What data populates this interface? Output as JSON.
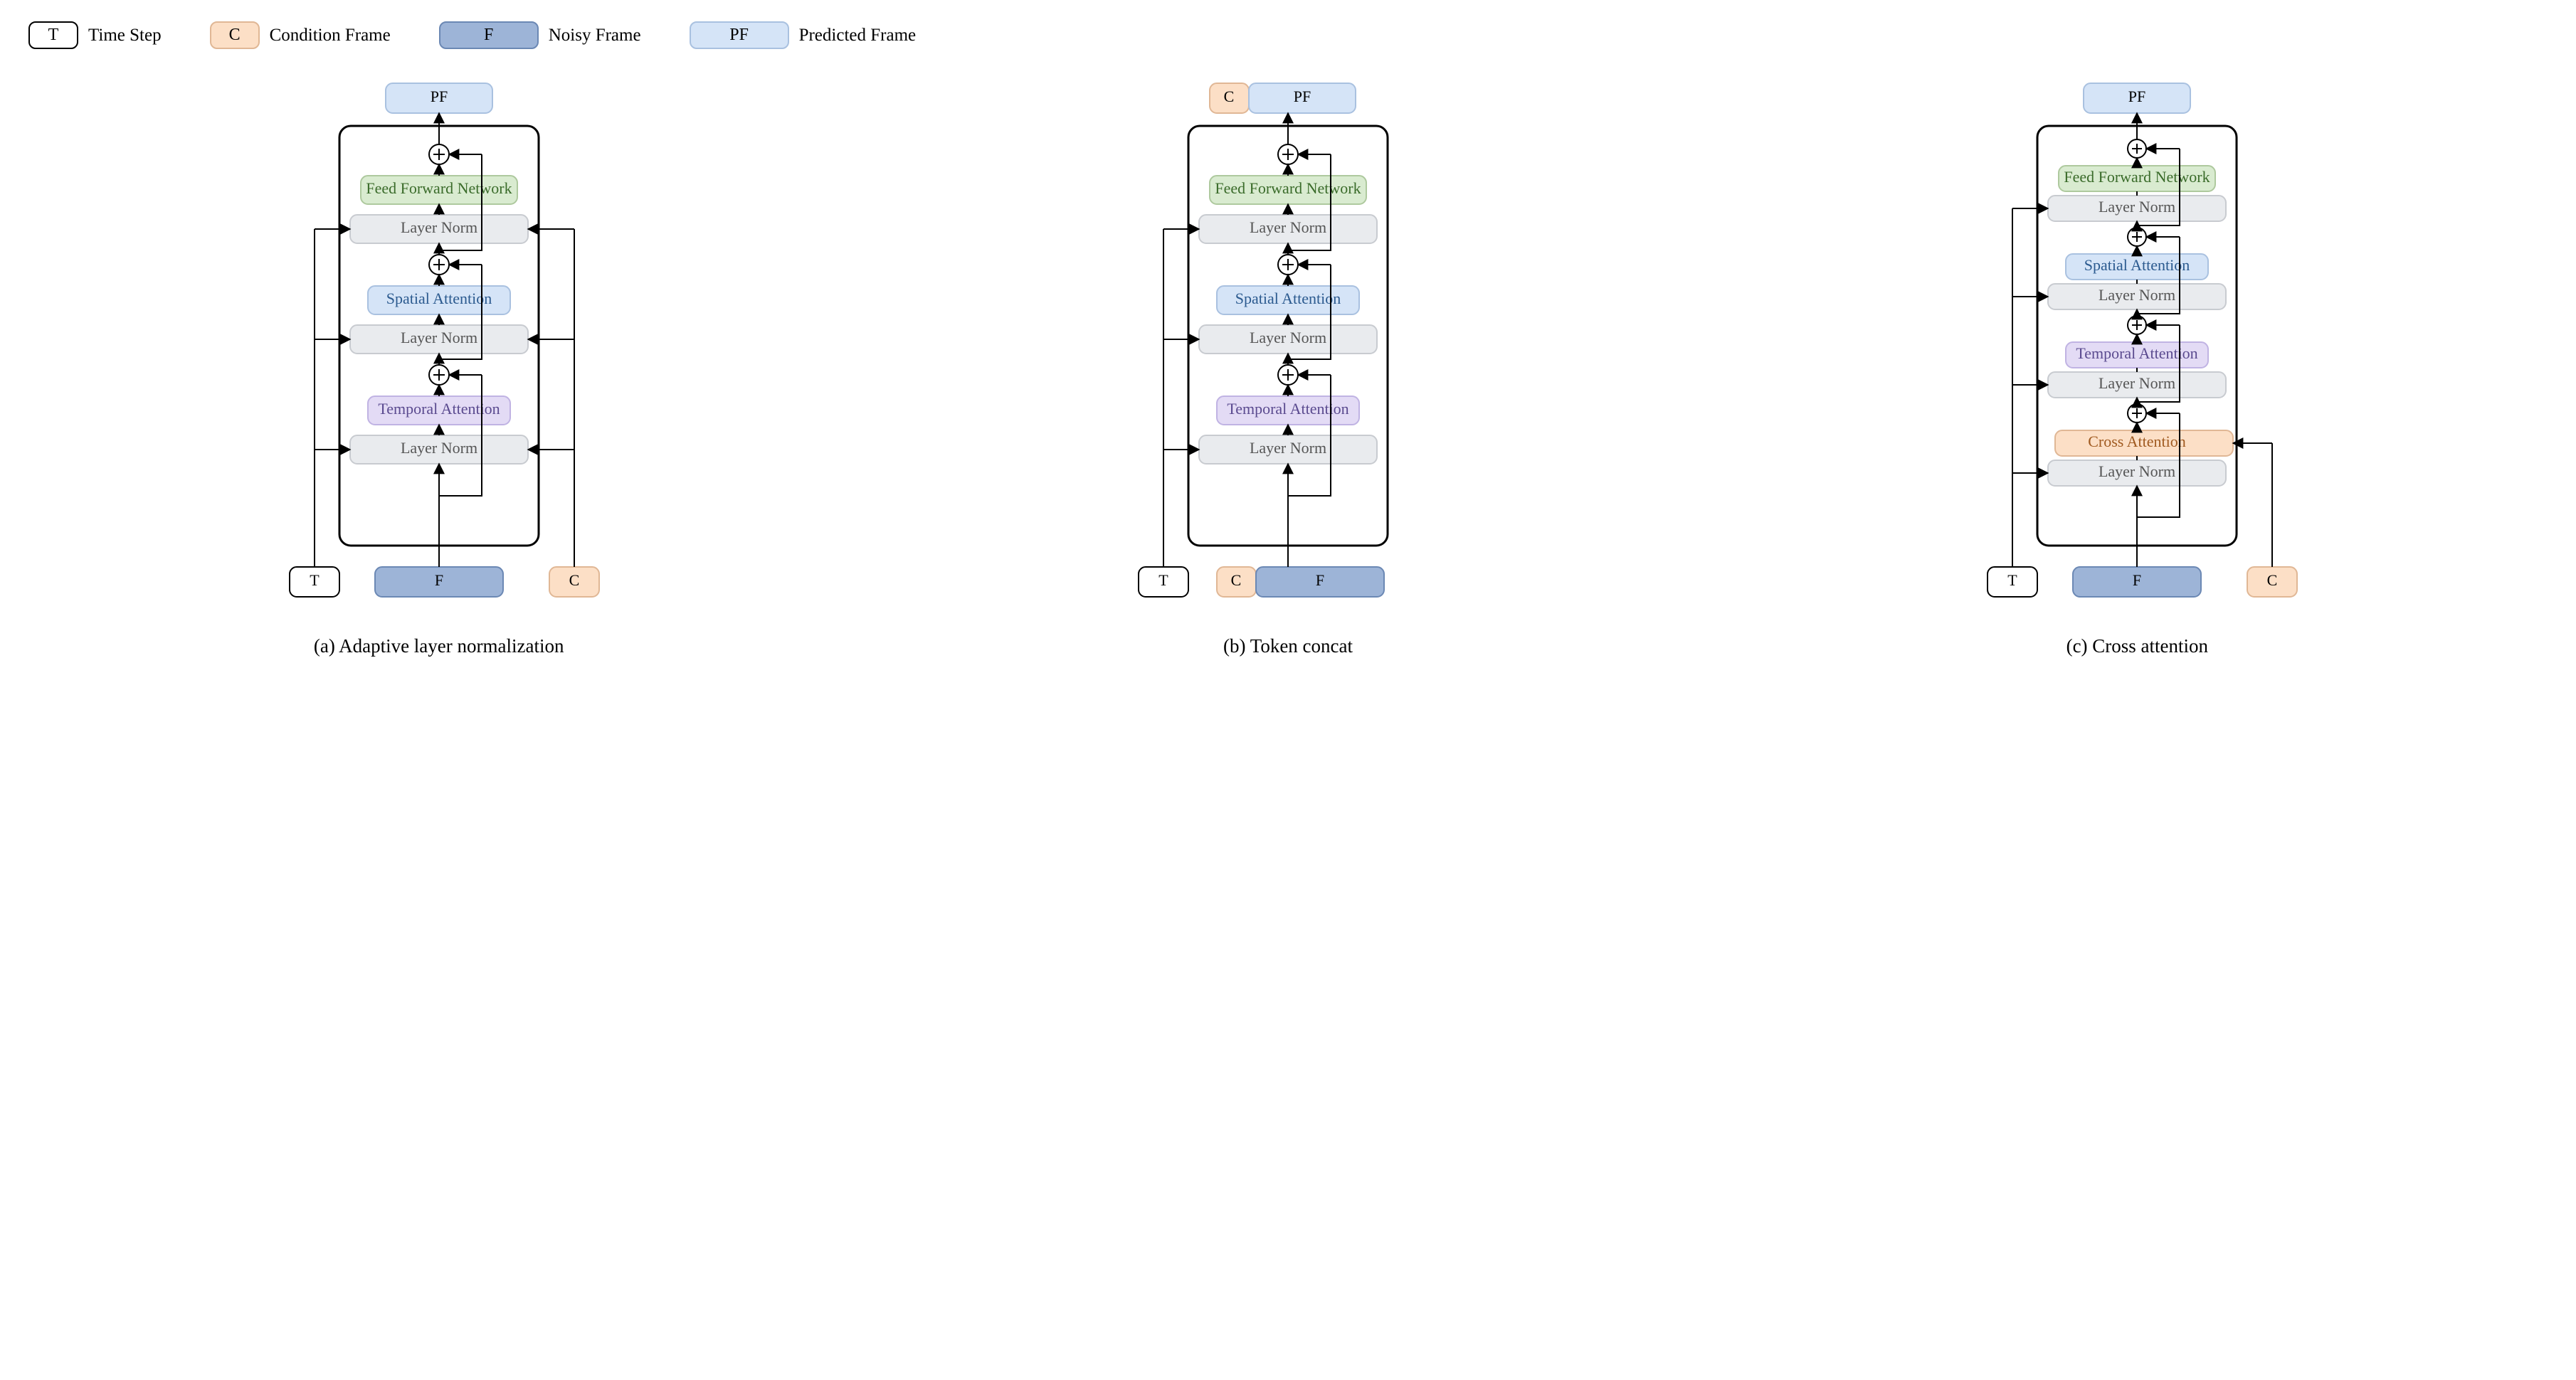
{
  "legend": {
    "t_box": "T",
    "t_label": "Time Step",
    "c_box": "C",
    "c_label": "Condition Frame",
    "f_box": "F",
    "f_label": "Noisy Frame",
    "pf_box": "PF",
    "pf_label": "Predicted Frame"
  },
  "blocks": {
    "layer_norm": "Layer Norm",
    "temporal_attention": "Temporal Attention",
    "spatial_attention": "Spatial Attention",
    "cross_attention": "Cross Attention",
    "ffn": "Feed Forward Network"
  },
  "io": {
    "t": "T",
    "c": "C",
    "f": "F",
    "pf": "PF"
  },
  "captions": {
    "a": "(a) Adaptive layer normalization",
    "b": "(b) Token concat",
    "c": "(c) Cross attention"
  }
}
